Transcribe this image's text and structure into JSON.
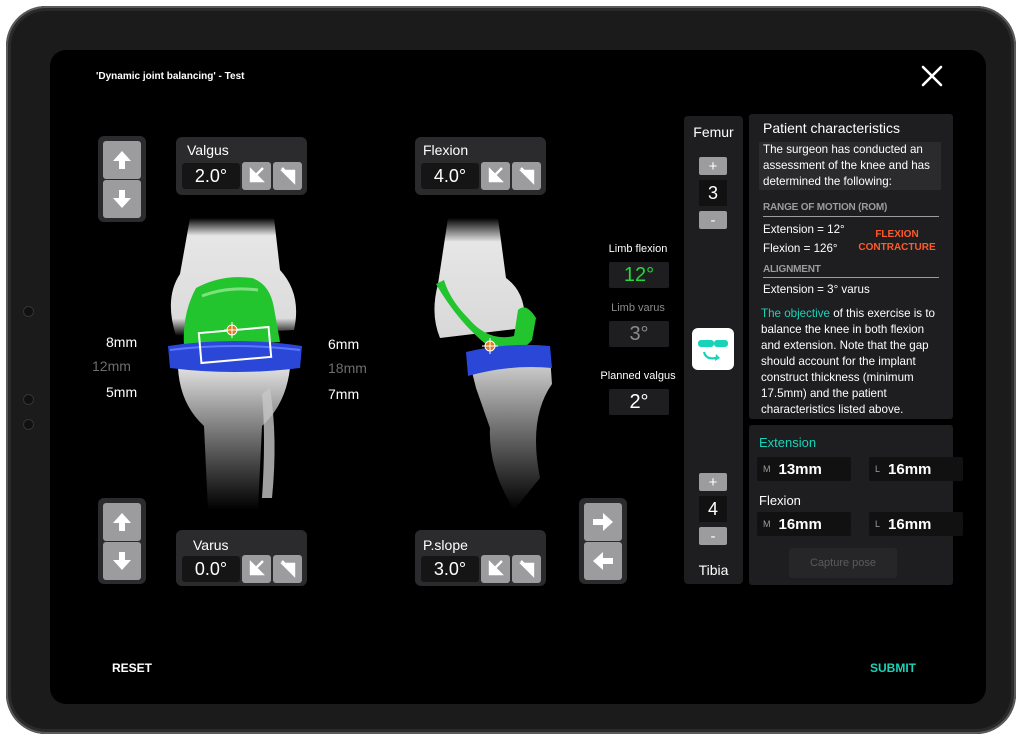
{
  "window": {
    "title": "'Dynamic joint balancing' - Test"
  },
  "controls": {
    "valgus": {
      "label": "Valgus",
      "value": "2.0°"
    },
    "varus": {
      "label": "Varus",
      "value": "0.0°"
    },
    "flexion": {
      "label": "Flexion",
      "value": "4.0°"
    },
    "pslope": {
      "label": "P.slope",
      "value": "3.0°"
    }
  },
  "gaps": {
    "left": [
      "8mm",
      "12mm",
      "5mm"
    ],
    "right": [
      "6mm",
      "18mm",
      "7mm"
    ]
  },
  "limb": {
    "flexion_label": "Limb flexion",
    "flexion_value": "12°",
    "varus_label": "Limb varus",
    "varus_value": "3°",
    "planned_label": "Planned valgus",
    "planned_value": "2°"
  },
  "column": {
    "femur_label": "Femur",
    "femur_value": "3",
    "tibia_label": "Tibia",
    "tibia_value": "4",
    "plus": "+",
    "minus": "-"
  },
  "patient": {
    "title": "Patient characteristics",
    "intro": "The surgeon has conducted an assessment of the knee and has determined the following:",
    "rom_heading": "RANGE OF MOTION (ROM)",
    "extension": "Extension = 12°",
    "flexion": "Flexion = 126°",
    "contracture": "FLEXION CONTRACTURE",
    "alignment_heading": "ALIGNMENT",
    "alignment": "Extension = 3° varus",
    "objective_link": "The objective",
    "objective_text": " of this exercise is to balance the knee in both flexion and extension. Note that the gap should account for the implant construct thickness (minimum 17.5mm) and the patient characteristics listed above."
  },
  "measures": {
    "extension_label": "Extension",
    "ext_m_key": "M",
    "ext_m_value": "13mm",
    "ext_l_key": "L",
    "ext_l_value": "16mm",
    "flexion_label": "Flexion",
    "flex_m_key": "M",
    "flex_m_value": "16mm",
    "flex_l_key": "L",
    "flex_l_value": "16mm",
    "capture_label": "Capture pose"
  },
  "footer": {
    "reset": "RESET",
    "submit": "SUBMIT"
  },
  "colors": {
    "accent": "#19d3b9",
    "implant_green": "#22c52e",
    "implant_blue": "#2b47d8",
    "contracture": "#ff5a2a"
  }
}
